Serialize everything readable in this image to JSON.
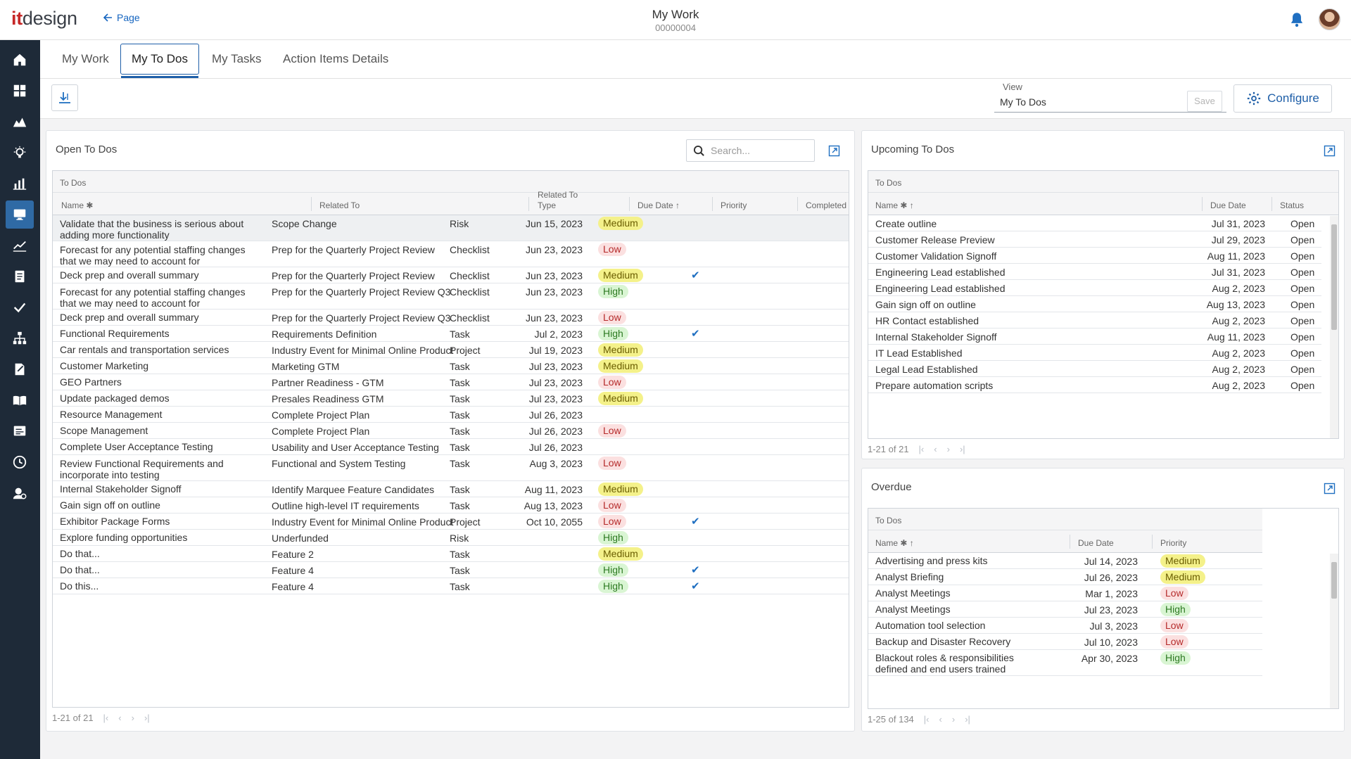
{
  "header": {
    "logo_it": "it",
    "logo_design": "design",
    "back_label": "Page",
    "title": "My Work",
    "subtitle": "00000004"
  },
  "tabs": [
    {
      "label": "My Work"
    },
    {
      "label": "My To Dos"
    },
    {
      "label": "My Tasks"
    },
    {
      "label": "Action Items Details"
    }
  ],
  "toolbar": {
    "view_label": "View",
    "view_value": "My To Dos",
    "save_label": "Save",
    "configure_label": "Configure"
  },
  "open_panel": {
    "title": "Open To Dos",
    "search_placeholder": "Search...",
    "caption": "To Dos",
    "columns": [
      "Name",
      "Related To",
      "Related To Type",
      "Due Date",
      "Priority",
      "Completed"
    ],
    "pager_text": "1-21 of 21",
    "rows": [
      {
        "name": "Validate that the business is serious about adding more functionality",
        "related": "Scope Change",
        "type": "Risk",
        "due": "Jun 15, 2023",
        "priority": "Medium",
        "completed": false
      },
      {
        "name": "Forecast for any potential staffing changes that we may need to account for",
        "related": "Prep for the Quarterly Project Review",
        "type": "Checklist",
        "due": "Jun 23, 2023",
        "priority": "Low",
        "completed": false
      },
      {
        "name": "Deck prep and overall summary",
        "related": "Prep for the Quarterly Project Review",
        "type": "Checklist",
        "due": "Jun 23, 2023",
        "priority": "Medium",
        "completed": true
      },
      {
        "name": "Forecast for any potential staffing changes that we may need to account for",
        "related": "Prep for the Quarterly Project Review Q3",
        "type": "Checklist",
        "due": "Jun 23, 2023",
        "priority": "High",
        "completed": false
      },
      {
        "name": "Deck prep and overall summary",
        "related": "Prep for the Quarterly Project Review Q3",
        "type": "Checklist",
        "due": "Jun 23, 2023",
        "priority": "Low",
        "completed": false
      },
      {
        "name": "Functional Requirements",
        "related": "Requirements Definition",
        "type": "Task",
        "due": "Jul 2, 2023",
        "priority": "High",
        "completed": true
      },
      {
        "name": "Car rentals and transportation services",
        "related": "Industry Event for Minimal Online Product",
        "type": "Project",
        "due": "Jul 19, 2023",
        "priority": "Medium",
        "completed": false
      },
      {
        "name": "Customer Marketing",
        "related": "Marketing GTM",
        "type": "Task",
        "due": "Jul 23, 2023",
        "priority": "Medium",
        "completed": false
      },
      {
        "name": "GEO Partners",
        "related": "Partner Readiness - GTM",
        "type": "Task",
        "due": "Jul 23, 2023",
        "priority": "Low",
        "completed": false
      },
      {
        "name": "Update packaged demos",
        "related": "Presales Readiness GTM",
        "type": "Task",
        "due": "Jul 23, 2023",
        "priority": "Medium",
        "completed": false
      },
      {
        "name": "Resource Management",
        "related": "Complete Project Plan",
        "type": "Task",
        "due": "Jul 26, 2023",
        "priority": "",
        "completed": false
      },
      {
        "name": "Scope Management",
        "related": "Complete Project Plan",
        "type": "Task",
        "due": "Jul 26, 2023",
        "priority": "Low",
        "completed": false
      },
      {
        "name": "Complete User Acceptance Testing",
        "related": "Usability and User Acceptance Testing",
        "type": "Task",
        "due": "Jul 26, 2023",
        "priority": "",
        "completed": false
      },
      {
        "name": "Review Functional Requirements and incorporate into testing",
        "related": "Functional and System Testing",
        "type": "Task",
        "due": "Aug 3, 2023",
        "priority": "Low",
        "completed": false
      },
      {
        "name": "Internal Stakeholder Signoff",
        "related": "Identify Marquee Feature Candidates",
        "type": "Task",
        "due": "Aug 11, 2023",
        "priority": "Medium",
        "completed": false
      },
      {
        "name": "Gain sign off on outline",
        "related": "Outline high-level IT requirements",
        "type": "Task",
        "due": "Aug 13, 2023",
        "priority": "Low",
        "completed": false
      },
      {
        "name": "Exhibitor Package Forms",
        "related": "Industry Event for Minimal Online Product",
        "type": "Project",
        "due": "Oct 10, 2055",
        "priority": "Low",
        "completed": true
      },
      {
        "name": "Explore funding opportunities",
        "related": "Underfunded",
        "type": "Risk",
        "due": "",
        "priority": "High",
        "completed": false
      },
      {
        "name": "Do that...",
        "related": "Feature 2",
        "type": "Task",
        "due": "",
        "priority": "Medium",
        "completed": false
      },
      {
        "name": "Do that...",
        "related": "Feature 4",
        "type": "Task",
        "due": "",
        "priority": "High",
        "completed": true
      },
      {
        "name": "Do this...",
        "related": "Feature 4",
        "type": "Task",
        "due": "",
        "priority": "High",
        "completed": true
      }
    ]
  },
  "upcoming_panel": {
    "title": "Upcoming To Dos",
    "caption": "To Dos",
    "columns": [
      "Name",
      "Due Date",
      "Status"
    ],
    "pager_text": "1-21 of 21",
    "rows": [
      {
        "name": "Create outline",
        "due": "Jul 31, 2023",
        "status": "Open"
      },
      {
        "name": "Customer Release Preview",
        "due": "Jul 29, 2023",
        "status": "Open"
      },
      {
        "name": "Customer Validation Signoff",
        "due": "Aug 11, 2023",
        "status": "Open"
      },
      {
        "name": "Engineering Lead established",
        "due": "Jul 31, 2023",
        "status": "Open"
      },
      {
        "name": "Engineering Lead established",
        "due": "Aug 2, 2023",
        "status": "Open"
      },
      {
        "name": "Gain sign off on outline",
        "due": "Aug 13, 2023",
        "status": "Open"
      },
      {
        "name": "HR Contact established",
        "due": "Aug 2, 2023",
        "status": "Open"
      },
      {
        "name": "Internal Stakeholder Signoff",
        "due": "Aug 11, 2023",
        "status": "Open"
      },
      {
        "name": "IT Lead Established",
        "due": "Aug 2, 2023",
        "status": "Open"
      },
      {
        "name": "Legal Lead Established",
        "due": "Aug 2, 2023",
        "status": "Open"
      },
      {
        "name": "Prepare automation scripts",
        "due": "Aug 2, 2023",
        "status": "Open"
      }
    ]
  },
  "overdue_panel": {
    "title": "Overdue",
    "caption": "To Dos",
    "columns": [
      "Name",
      "Due Date",
      "Priority"
    ],
    "pager_text": "1-25 of 134",
    "rows": [
      {
        "name": "Advertising and press kits",
        "due": "Jul 14, 2023",
        "priority": "Medium"
      },
      {
        "name": "Analyst Briefing",
        "due": "Jul 26, 2023",
        "priority": "Medium"
      },
      {
        "name": "Analyst Meetings",
        "due": "Mar 1, 2023",
        "priority": "Low"
      },
      {
        "name": "Analyst Meetings",
        "due": "Jul 23, 2023",
        "priority": "High"
      },
      {
        "name": "Automation tool selection",
        "due": "Jul 3, 2023",
        "priority": "Low"
      },
      {
        "name": "Backup and Disaster Recovery",
        "due": "Jul 10, 2023",
        "priority": "Low"
      },
      {
        "name": "Blackout roles & responsibilities defined and end users trained",
        "due": "Apr 30, 2023",
        "priority": "High"
      }
    ]
  },
  "colors": {
    "brand_red": "#c62828",
    "accent_blue": "#1f5fa8",
    "rail_bg": "#1e2a38",
    "medium": "#f4f18a",
    "low": "#fbe0e0",
    "high": "#d9f5d3"
  },
  "rail_icons": [
    "home-icon",
    "dashboard-icon",
    "portfolio-icon",
    "ideas-icon",
    "reports-icon",
    "my-work-icon",
    "analytics-icon",
    "documents-icon",
    "approvals-icon",
    "org-chart-icon",
    "timesheet-icon",
    "library-icon",
    "worklist-icon",
    "time-icon",
    "admin-icon"
  ]
}
